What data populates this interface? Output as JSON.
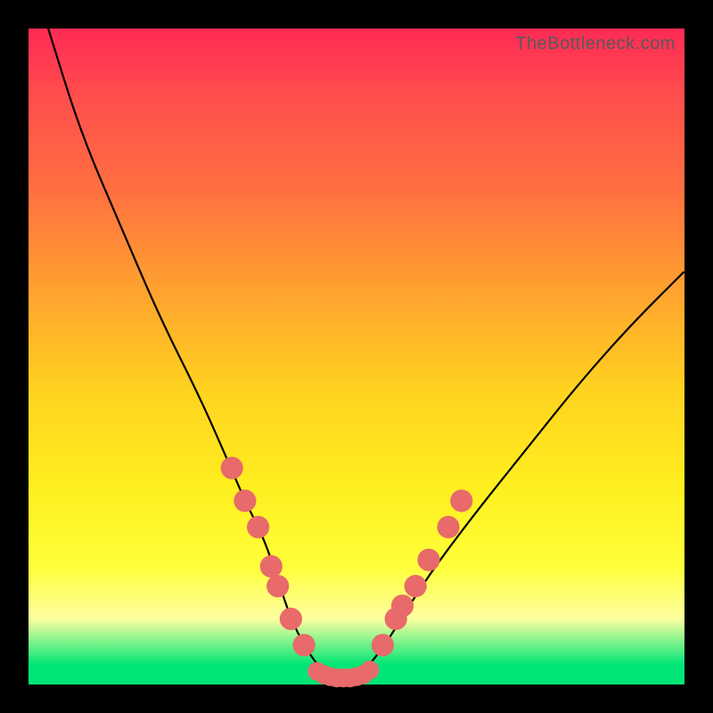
{
  "watermark": "TheBottleneck.com",
  "chart_data": {
    "type": "line",
    "title": "",
    "xlabel": "",
    "ylabel": "",
    "xlim": [
      0,
      100
    ],
    "ylim": [
      0,
      100
    ],
    "series": [
      {
        "name": "bottleneck-curve",
        "x": [
          3,
          8,
          14,
          20,
          26,
          30,
          33,
          36,
          38,
          40,
          42,
          44,
          46,
          48,
          50,
          52,
          55,
          58,
          62,
          68,
          76,
          84,
          92,
          100
        ],
        "values": [
          100,
          84,
          70,
          56,
          44,
          35,
          28,
          22,
          16,
          10,
          6,
          3,
          1,
          1,
          1,
          3,
          7,
          12,
          18,
          26,
          36,
          46,
          55,
          63
        ]
      }
    ],
    "markers": [
      {
        "name": "left-cluster",
        "points": [
          {
            "x": 31,
            "y": 33,
            "r": 1.3
          },
          {
            "x": 33,
            "y": 28,
            "r": 1.3
          },
          {
            "x": 35,
            "y": 24,
            "r": 1.3
          },
          {
            "x": 37,
            "y": 18,
            "r": 1.3
          },
          {
            "x": 38,
            "y": 15,
            "r": 1.3
          },
          {
            "x": 40,
            "y": 10,
            "r": 1.3
          },
          {
            "x": 42,
            "y": 6,
            "r": 1.3
          }
        ]
      },
      {
        "name": "bottom-bar",
        "points": [
          {
            "x": 44,
            "y": 2,
            "r": 1.0
          },
          {
            "x": 45,
            "y": 1.5,
            "r": 1.0
          },
          {
            "x": 46,
            "y": 1.2,
            "r": 1.0
          },
          {
            "x": 47,
            "y": 1.0,
            "r": 1.0
          },
          {
            "x": 48,
            "y": 1.0,
            "r": 1.0
          },
          {
            "x": 49,
            "y": 1.0,
            "r": 1.0
          },
          {
            "x": 50,
            "y": 1.2,
            "r": 1.0
          },
          {
            "x": 51,
            "y": 1.5,
            "r": 1.0
          },
          {
            "x": 52,
            "y": 2.2,
            "r": 1.0
          }
        ]
      },
      {
        "name": "right-cluster",
        "points": [
          {
            "x": 54,
            "y": 6,
            "r": 1.3
          },
          {
            "x": 56,
            "y": 10,
            "r": 1.3
          },
          {
            "x": 57,
            "y": 12,
            "r": 1.3
          },
          {
            "x": 59,
            "y": 15,
            "r": 1.3
          },
          {
            "x": 61,
            "y": 19,
            "r": 1.3
          },
          {
            "x": 64,
            "y": 24,
            "r": 1.3
          },
          {
            "x": 66,
            "y": 28,
            "r": 1.3
          }
        ]
      }
    ],
    "colors": {
      "curve": "#000000",
      "marker": "#e86a6a",
      "gradient_top": "#ff2a55",
      "gradient_bottom": "#00e676"
    }
  }
}
